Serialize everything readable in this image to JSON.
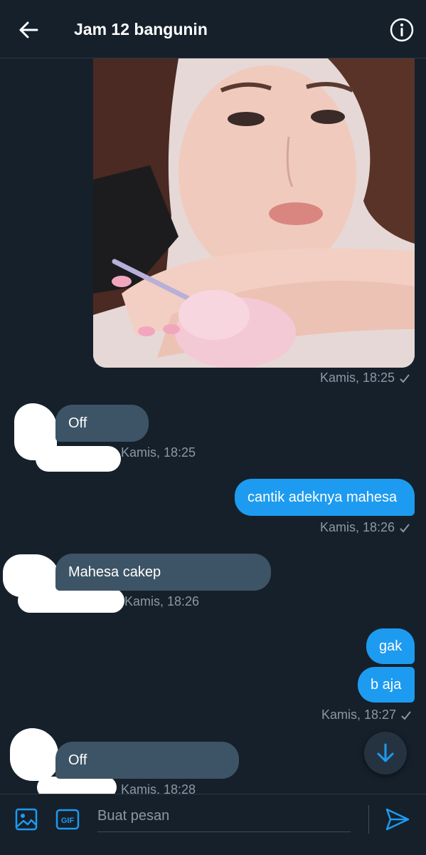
{
  "header": {
    "title": "Jam 12 bangunin"
  },
  "messages": [
    {
      "kind": "image",
      "direction": "out",
      "timestamp": "Kamis, 18:25"
    },
    {
      "kind": "text",
      "direction": "in",
      "text": "Off",
      "timestamp": "Kamis, 18:25"
    },
    {
      "kind": "text",
      "direction": "out",
      "text": "cantik adeknya mahesa",
      "timestamp": "Kamis, 18:26"
    },
    {
      "kind": "text",
      "direction": "in",
      "text": "Mahesa cakep",
      "timestamp": "Kamis, 18:26"
    },
    {
      "kind": "text",
      "direction": "out",
      "text": "gak"
    },
    {
      "kind": "text",
      "direction": "out",
      "text": "b aja",
      "timestamp": "Kamis, 18:27"
    },
    {
      "kind": "text",
      "direction": "in",
      "text": "Off",
      "timestamp": "Kamis, 18:28"
    }
  ],
  "composer": {
    "placeholder": "Buat pesan",
    "gif_label": "GIF"
  },
  "icons": {
    "back": "arrow-left-icon",
    "info": "info-icon",
    "media": "image-icon",
    "gif": "gif-icon",
    "send": "send-icon",
    "scroll": "arrow-down-icon"
  },
  "colors": {
    "background": "#15202b",
    "accent": "#1d9bf0",
    "incoming_bubble": "#3d5466",
    "muted_text": "#8b98a5"
  }
}
